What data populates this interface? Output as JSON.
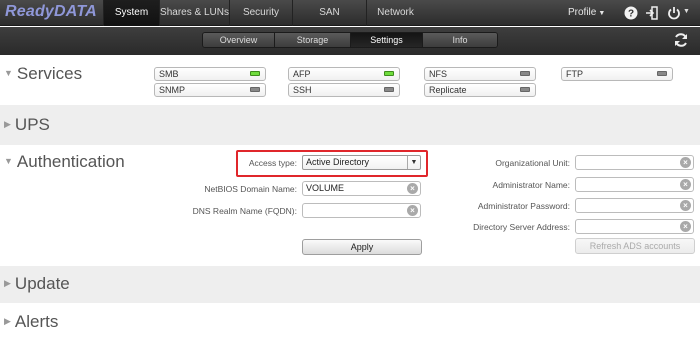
{
  "brand": "ReadyDATA",
  "top_nav": [
    "System",
    "Shares & LUNs",
    "Security",
    "SAN",
    "Network"
  ],
  "profile": {
    "label": "Profile"
  },
  "sub_tabs": [
    "Overview",
    "Storage",
    "Settings",
    "Info"
  ],
  "sections": {
    "services": "Services",
    "ups": "UPS",
    "authentication": "Authentication",
    "update": "Update",
    "alerts": "Alerts"
  },
  "services": [
    {
      "label": "SMB",
      "status": "on"
    },
    {
      "label": "AFP",
      "status": "on"
    },
    {
      "label": "NFS",
      "status": "off"
    },
    {
      "label": "FTP",
      "status": "off"
    },
    {
      "label": "SNMP",
      "status": "off"
    },
    {
      "label": "SSH",
      "status": "off"
    },
    {
      "label": "Replicate",
      "status": "off"
    }
  ],
  "auth": {
    "access_type_label": "Access type:",
    "access_type_value": "Active Directory",
    "netbios_label": "NetBIOS Domain Name:",
    "netbios_value": "VOLUME",
    "dns_label": "DNS Realm Name (FQDN):",
    "dns_value": "",
    "apply_label": "Apply",
    "org_unit_label": "Organizational Unit:",
    "admin_name_label": "Administrator Name:",
    "admin_password_label": "Administrator Password:",
    "dir_server_label": "Directory Server Address:",
    "refresh_ads_label": "Refresh ADS accounts"
  },
  "colors": {
    "led_on": "#6fdc3c",
    "highlight": "#e0262b",
    "brand": "#8f97d8"
  }
}
